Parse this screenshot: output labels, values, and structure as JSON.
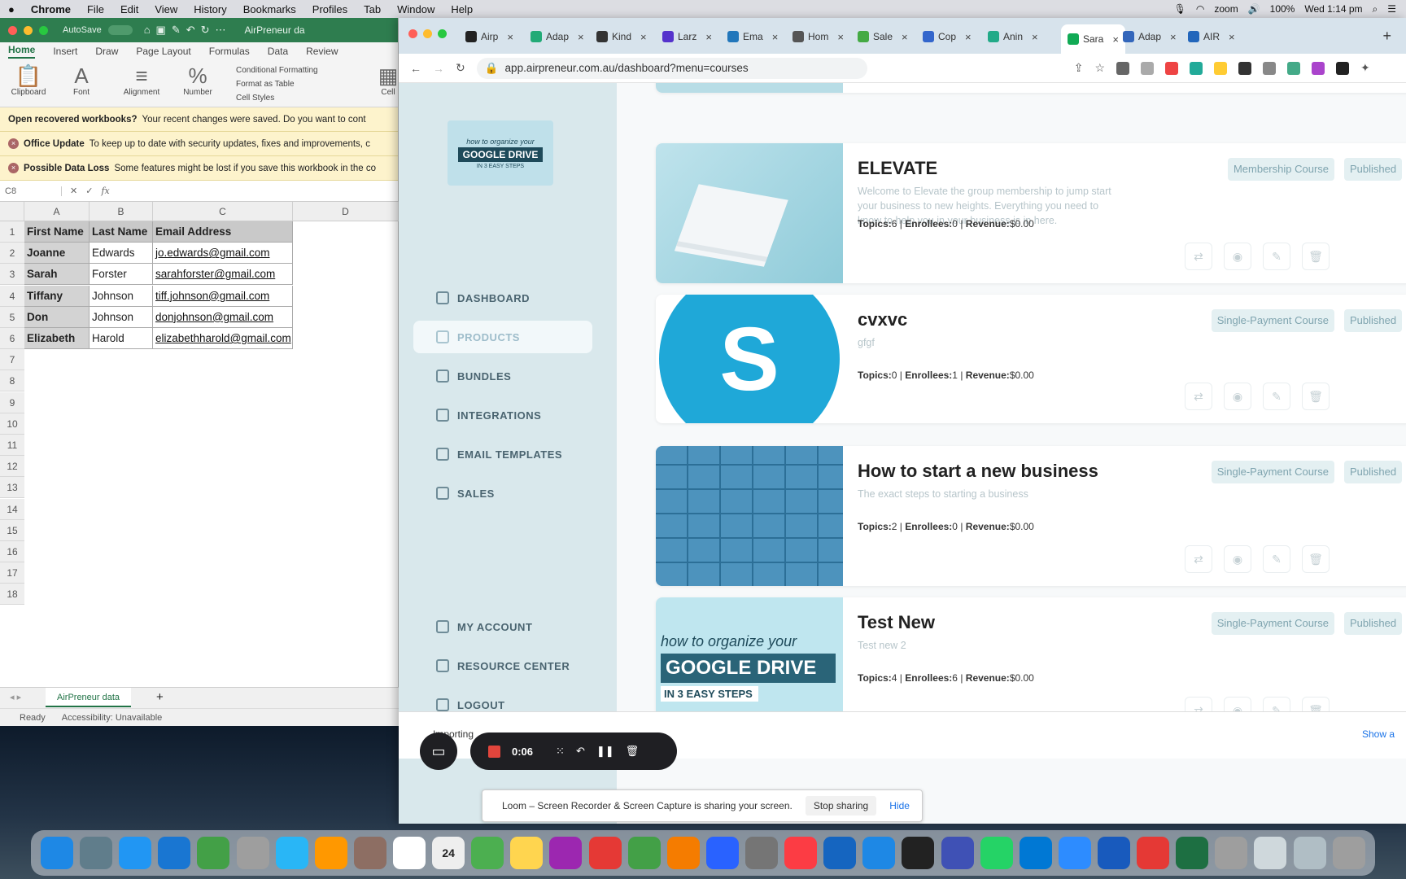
{
  "menubar": {
    "apple": "",
    "app": "Chrome",
    "items": [
      "File",
      "Edit",
      "View",
      "History",
      "Bookmarks",
      "Profiles",
      "Tab",
      "Window",
      "Help"
    ],
    "zoom": "zoom",
    "battery": "100%",
    "clock": "Wed 1:14 pm"
  },
  "excel": {
    "autosave": "AutoSave",
    "doc_title": "AirPreneur da",
    "tabs": [
      "Home",
      "Insert",
      "Draw",
      "Page Layout",
      "Formulas",
      "Data",
      "Review"
    ],
    "ribbon": {
      "clipboard": "Clipboard",
      "font": "Font",
      "alignment": "Alignment",
      "number": "Number",
      "cond_format": "Conditional Formatting",
      "format_table": "Format as Table",
      "cell_styles": "Cell Styles",
      "cells": "Cell"
    },
    "banners": [
      {
        "bold": "Open recovered workbooks?",
        "text": "Your recent changes were saved. Do you want to cont"
      },
      {
        "bold": "Office Update",
        "text": "To keep up to date with security updates, fixes and improvements, c"
      },
      {
        "bold": "Possible Data Loss",
        "text": "Some features might be lost if you save this workbook in the co"
      }
    ],
    "namebox": "C8",
    "fx": "fx",
    "columns": [
      "A",
      "B",
      "C",
      "D"
    ],
    "rows": [
      "1",
      "2",
      "3",
      "4",
      "5",
      "6",
      "7",
      "8",
      "9",
      "10",
      "11",
      "12",
      "13",
      "14",
      "15",
      "16",
      "17",
      "18"
    ],
    "headers": [
      "First Name",
      "Last Name",
      "Email Address"
    ],
    "data": [
      [
        "Joanne",
        "Edwards",
        "jo.edwards@gmail.com"
      ],
      [
        "Sarah",
        "Forster",
        "sarahforster@gmail.com"
      ],
      [
        "Tiffany",
        "Johnson",
        "tiff.johnson@gmail.com"
      ],
      [
        "Don",
        "Johnson",
        "donjohnson@gmail.com"
      ],
      [
        "Elizabeth",
        "Harold",
        "elizabethharold@gmail.com"
      ]
    ],
    "sheet_tab": "AirPreneur data",
    "add_sheet": "+",
    "status_ready": "Ready",
    "status_access": "Accessibility: Unavailable"
  },
  "chrome": {
    "tabs": [
      "Airp",
      "Adap",
      "Kind",
      "Larz",
      "Ema",
      "Hom",
      "Sale",
      "Cop",
      "Anin",
      "Sara",
      "Adap",
      "AIR"
    ],
    "new_tab": "+",
    "url": "app.airpreneur.com.au/dashboard?menu=courses"
  },
  "sidebar": {
    "logo_line1": "how to organize your",
    "logo_line2": "GOOGLE DRIVE",
    "logo_line3": "IN 3 EASY STEPS",
    "nav": [
      "DASHBOARD",
      "PRODUCTS",
      "BUNDLES",
      "INTEGRATIONS",
      "EMAIL TEMPLATES",
      "SALES"
    ],
    "nav_bottom": [
      "MY ACCOUNT",
      "RESOURCE CENTER",
      "LOGOUT"
    ]
  },
  "courses": [
    {
      "title": "ELEVATE",
      "desc": "Welcome to Elevate the group membership to jump start your business to new heights.  Everything you need to know to help you in your business is in here.",
      "topics": "6",
      "enrollees": "0",
      "revenue": "$0.00",
      "type": "Membership Course",
      "status": "Published"
    },
    {
      "title": "cvxvc",
      "desc": "gfgf",
      "topics": "0",
      "enrollees": "1",
      "revenue": "$0.00",
      "type": "Single-Payment Course",
      "status": "Published"
    },
    {
      "title": "How to start a new business",
      "desc": "The exact steps to starting a business",
      "topics": "2",
      "enrollees": "0",
      "revenue": "$0.00",
      "type": "Single-Payment Course",
      "status": "Published"
    },
    {
      "title": "Test New",
      "desc": "Test new 2",
      "topics": "4",
      "enrollees": "6",
      "revenue": "$0.00",
      "type": "Single-Payment Course",
      "status": "Published"
    }
  ],
  "meta_labels": {
    "topics": "Topics:",
    "enrollees": "Enrollees:",
    "revenue": "Revenue:"
  },
  "thumb_text": {
    "s_letter": "S",
    "gd_line1": "how to organize your",
    "gd_line2": "GOOGLE DRIVE",
    "gd_line3": "IN 3 EASY STEPS"
  },
  "loom": {
    "timer": "0:06",
    "importing": "Importing",
    "notice": "Loom – Screen Recorder & Screen Capture is sharing your screen.",
    "stop": "Stop sharing",
    "hide": "Hide",
    "show_all": "Show a"
  },
  "dock": {
    "calendar_day": "24"
  }
}
